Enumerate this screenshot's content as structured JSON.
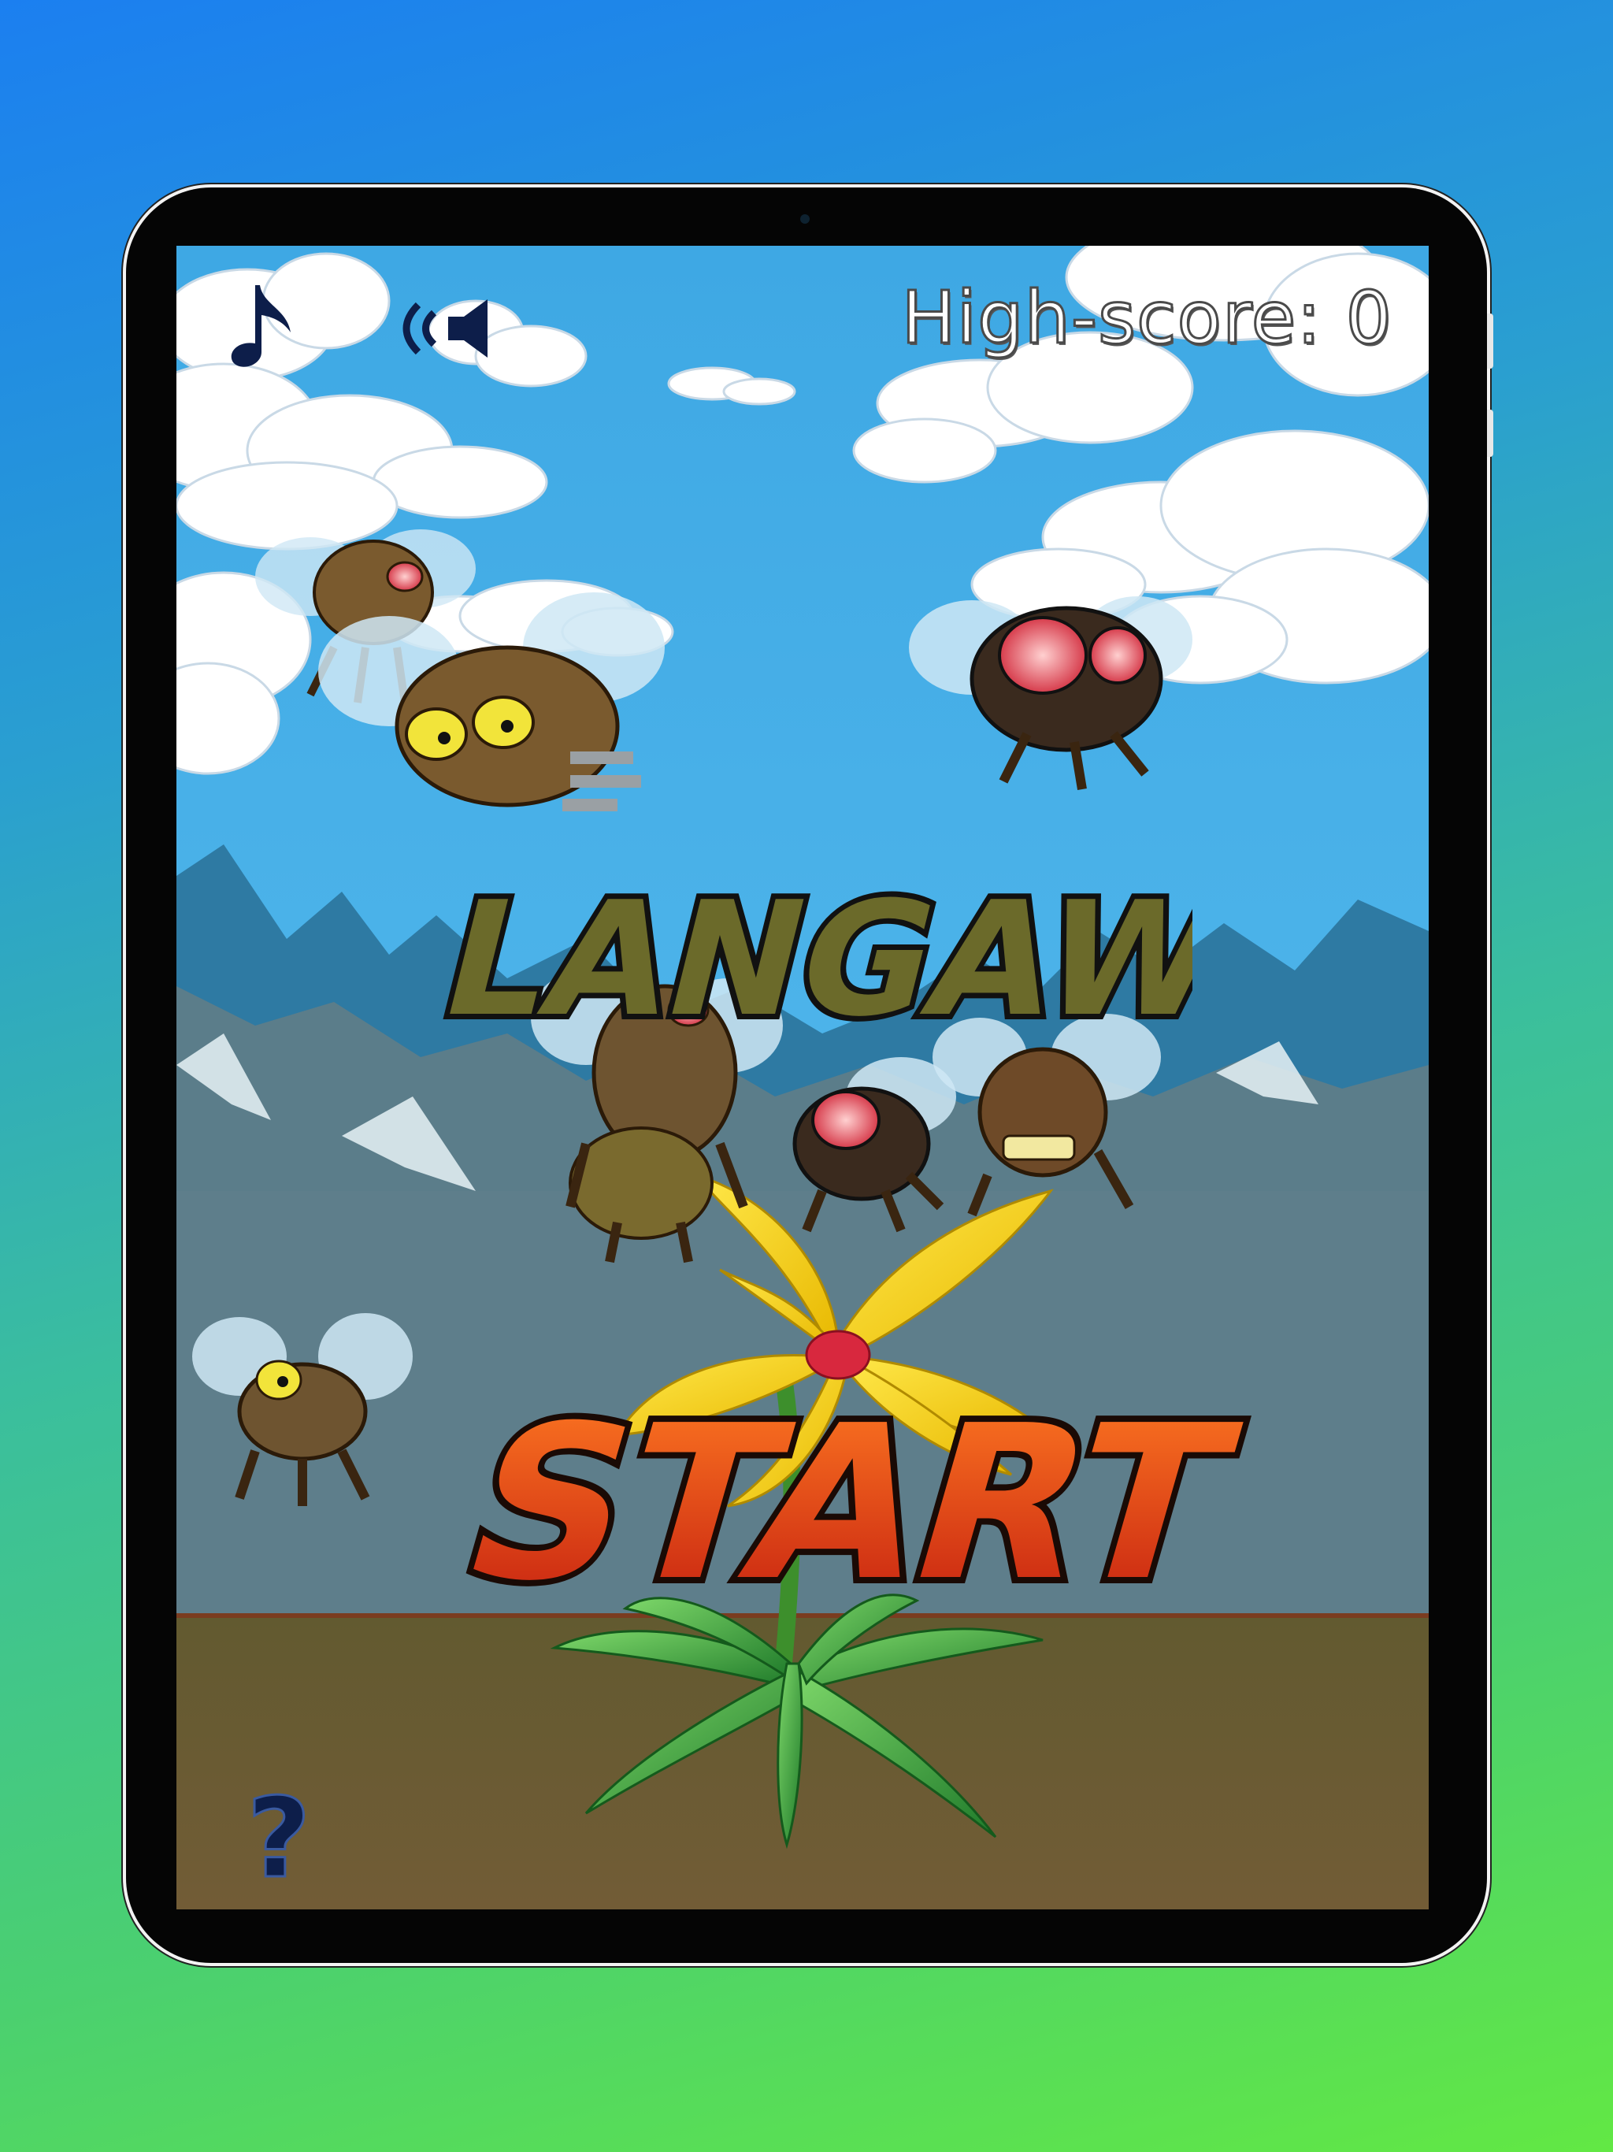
{
  "screen": {
    "high_score_label": "High-score: 0",
    "title": "LANGAW",
    "start_label": "START",
    "help_label": "?"
  },
  "icons": {
    "music": "music-note-icon",
    "sound": "speaker-icon",
    "help": "question-mark-icon"
  },
  "colors": {
    "sky": "#4fb2e6",
    "ground": "#6b5a32",
    "start_fill": "#e63b12",
    "title_fill": "#6b6a2a"
  }
}
